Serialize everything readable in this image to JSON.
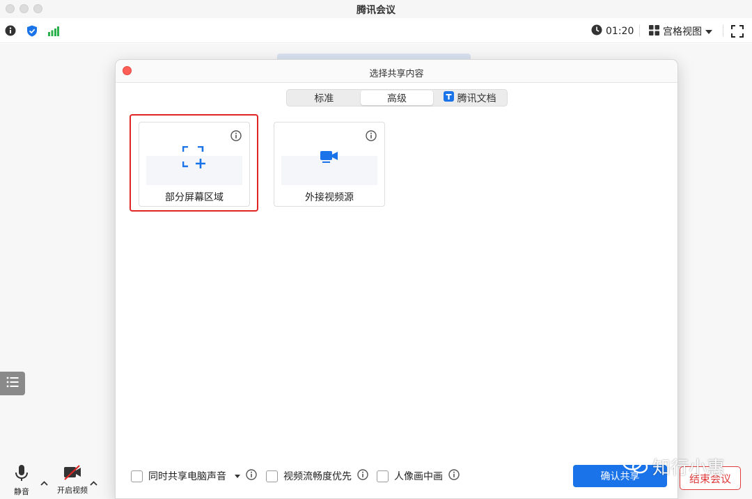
{
  "window": {
    "title": "腾讯会议"
  },
  "toolbar": {
    "timer": "01:20",
    "view_label": "宫格视图"
  },
  "dialog": {
    "title": "选择共享内容",
    "tabs": [
      {
        "label": "标准",
        "active": false
      },
      {
        "label": "高级",
        "active": true
      },
      {
        "label": "腾讯文档",
        "active": false
      }
    ],
    "cards": [
      {
        "label": "部分屏幕区域",
        "icon": "region-select-icon",
        "highlighted": true
      },
      {
        "label": "外接视频源",
        "icon": "external-camera-icon",
        "highlighted": false
      }
    ],
    "options": [
      {
        "label": "同时共享电脑声音"
      },
      {
        "label": "视频流畅度优先"
      },
      {
        "label": "人像画中画"
      }
    ],
    "confirm_label": "确认共享"
  },
  "bottom": {
    "mute_label": "静音",
    "video_label": "开启视频",
    "end_label": "结束会议"
  },
  "watermark": {
    "text": "知行小惠"
  },
  "colors": {
    "accent": "#1a73e8",
    "danger": "#e02424",
    "close": "#ff5f57",
    "signal": "#2bb24c"
  }
}
